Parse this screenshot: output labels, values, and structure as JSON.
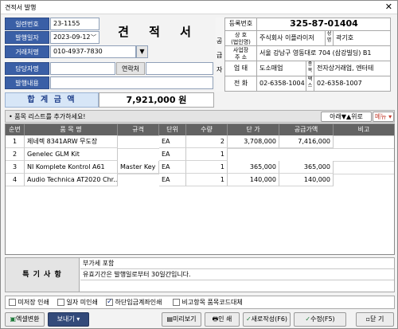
{
  "window": {
    "title": "견적서 발행",
    "close_icon": "close-icon"
  },
  "doc_title": "견 적 서",
  "left_form": {
    "receipt_no_label": "일련번호",
    "receipt_no": "23-1155",
    "date_label": "발행일자",
    "date": "2023-09-12",
    "client_label": "거래처명",
    "client": "010-4937-7830",
    "contact_label": "담당자명",
    "contact": "",
    "phone_label": "연락처",
    "phone": "",
    "memo_label": "발행내용",
    "memo": ""
  },
  "supplier": {
    "side_label_chars": [
      "공",
      "급",
      "자"
    ],
    "reg_no_label": "등록번호",
    "reg_no": "325-87-01404",
    "company_label": "상 호\n(법인명)",
    "company_label_l1": "상 호",
    "company_label_l2": "(법인명)",
    "company": "주식회사 이플라이저",
    "ceo_label": "성명",
    "ceo": "곽기호",
    "address_label_l1": "사업장",
    "address_label_l2": "주 소",
    "address": "서울 강남구 영동대로 704 (삼강빌딩) B1",
    "biz_type_label": "업 태",
    "biz_type": "도소매업",
    "biz_item_label": "종목",
    "biz_item": "전자상거래업, 엔터테",
    "tel_label": "전 화",
    "tel": "02-6358-1004",
    "fax_label": "팩스",
    "fax": "02-6358-1007"
  },
  "total": {
    "label": "합 계 금 액",
    "value": "7,921,000 원"
  },
  "list_bar": {
    "prompt": "• 품목 리스트를 추가하세요!",
    "down_label": "아래",
    "up_label": "위로",
    "menu_label": "메뉴"
  },
  "grid": {
    "headers": [
      "순번",
      "품 목 명",
      "규격",
      "단위",
      "수량",
      "단 가",
      "공급가액",
      "비고"
    ],
    "rows": [
      {
        "no": "1",
        "name": "제네렉 8341ARW 무도장",
        "spec": "",
        "unit": "EA",
        "qty": "2",
        "price": "3,708,000",
        "amount": "7,416,000",
        "note": ""
      },
      {
        "no": "2",
        "name": "Genelec GLM Kit",
        "spec": "",
        "unit": "EA",
        "qty": "1",
        "price": "",
        "amount": "",
        "note": ""
      },
      {
        "no": "3",
        "name": "NI Komplete Kontrol A61",
        "spec": "Master Key",
        "unit": "EA",
        "qty": "1",
        "price": "365,000",
        "amount": "365,000",
        "note": ""
      },
      {
        "no": "4",
        "name": "Audio Technica AT2020 Chr...",
        "spec": "",
        "unit": "EA",
        "qty": "1",
        "price": "140,000",
        "amount": "140,000",
        "note": ""
      }
    ]
  },
  "remarks": {
    "label": "특 기 사 항",
    "line1": "부가세 포함",
    "line2": "유효기간은 발행일로부터 30일간입니다."
  },
  "options": [
    {
      "label": "미저장 인쇄",
      "checked": false
    },
    {
      "label": "일자 미인쇄",
      "checked": false
    },
    {
      "label": "하단입금계좌인쇄",
      "checked": true
    },
    {
      "label": "비고항목 품목코드대체",
      "checked": false
    }
  ],
  "buttons": {
    "excel": "엑셀변환",
    "send": "보내기",
    "preview": "미리보기",
    "print": "인 쇄",
    "new": "새로작성(F6)",
    "edit": "수정(F5)",
    "close": "닫 기"
  },
  "colors": {
    "label_blue": "#3a5fa6",
    "header_gray": "#636363",
    "total_bg": "#d7e6f7",
    "menu_red": "#c0392b"
  }
}
